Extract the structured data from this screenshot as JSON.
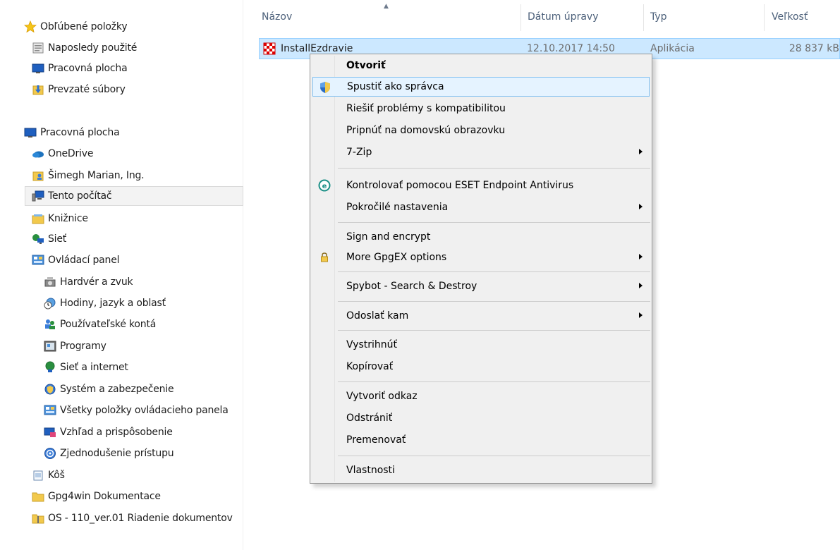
{
  "nav": {
    "items": [
      {
        "label": "Obľúbené položky",
        "icon": "star-icon"
      },
      {
        "label": "Naposledy použité",
        "icon": "recent-places-icon"
      },
      {
        "label": "Pracovná plocha",
        "icon": "desktop-icon"
      },
      {
        "label": "Prevzaté súbory",
        "icon": "downloads-icon"
      },
      {
        "label": "Pracovná plocha",
        "icon": "desktop-icon"
      },
      {
        "label": "OneDrive",
        "icon": "onedrive-icon"
      },
      {
        "label": "Šimegh Marian, Ing.",
        "icon": "user-folder-icon"
      },
      {
        "label": "Tento počítač",
        "icon": "computer-icon"
      },
      {
        "label": "Knižnice",
        "icon": "libraries-icon"
      },
      {
        "label": "Sieť",
        "icon": "network-icon"
      },
      {
        "label": "Ovládací panel",
        "icon": "control-panel-icon"
      },
      {
        "label": "Hardvér a zvuk",
        "icon": "hardware-sound-icon"
      },
      {
        "label": "Hodiny, jazyk a oblasť",
        "icon": "clock-globe-icon"
      },
      {
        "label": "Používateľské kontá",
        "icon": "user-accounts-icon"
      },
      {
        "label": "Programy",
        "icon": "programs-icon"
      },
      {
        "label": "Sieť a internet",
        "icon": "network-internet-icon"
      },
      {
        "label": "Systém a zabezpečenie",
        "icon": "system-security-icon"
      },
      {
        "label": "Všetky položky ovládacieho panela",
        "icon": "control-panel-icon"
      },
      {
        "label": "Vzhľad a prispôsobenie",
        "icon": "appearance-icon"
      },
      {
        "label": "Zjednodušenie prístupu",
        "icon": "ease-of-access-icon"
      },
      {
        "label": "Kôš",
        "icon": "recycle-bin-icon"
      },
      {
        "label": "Gpg4win Dokumentace",
        "icon": "folder-icon"
      },
      {
        "label": "OS - 110_ver.01 Riadenie dokumentov",
        "icon": "zip-folder-icon"
      }
    ],
    "selected": "Tento počítač"
  },
  "columns": {
    "name": "Názov",
    "date": "Dátum úpravy",
    "type": "Typ",
    "size": "Veľkosť"
  },
  "file": {
    "name": "InstallEzdravie",
    "date": "12.10.2017 14:50",
    "type": "Aplikácia",
    "size": "28 837 kB",
    "icon": "installer-icon"
  },
  "context_menu": {
    "items": [
      {
        "label": "Otvoriť",
        "bold": true
      },
      {
        "label": "Spustiť ako správca",
        "icon": "uac-shield-icon",
        "highlighted": true
      },
      {
        "label": "Riešiť problémy s kompatibilitou"
      },
      {
        "label": "Pripnúť na domovskú obrazovku"
      },
      {
        "label": "7-Zip",
        "submenu": true
      },
      {
        "label": "Kontrolovať pomocou ESET Endpoint Antivirus",
        "icon": "eset-icon"
      },
      {
        "label": "Pokročilé nastavenia",
        "submenu": true
      },
      {
        "label": "Sign and encrypt"
      },
      {
        "label": "More GpgEX options",
        "icon": "lock-icon",
        "submenu": true
      },
      {
        "label": "Spybot - Search & Destroy",
        "submenu": true
      },
      {
        "label": "Odoslať kam",
        "submenu": true
      },
      {
        "label": "Vystrihnúť"
      },
      {
        "label": "Kopírovať"
      },
      {
        "label": "Vytvoriť odkaz"
      },
      {
        "label": "Odstrániť"
      },
      {
        "label": "Premenovať"
      },
      {
        "label": "Vlastnosti"
      }
    ]
  },
  "colors": {
    "selection_fill": "#cce8ff",
    "selection_border": "#99d1ff",
    "menu_bg": "#f0f0f0",
    "menu_highlight": "#e5f3ff",
    "menu_highlight_border": "#7fbef0",
    "header_text": "#4c607a"
  }
}
